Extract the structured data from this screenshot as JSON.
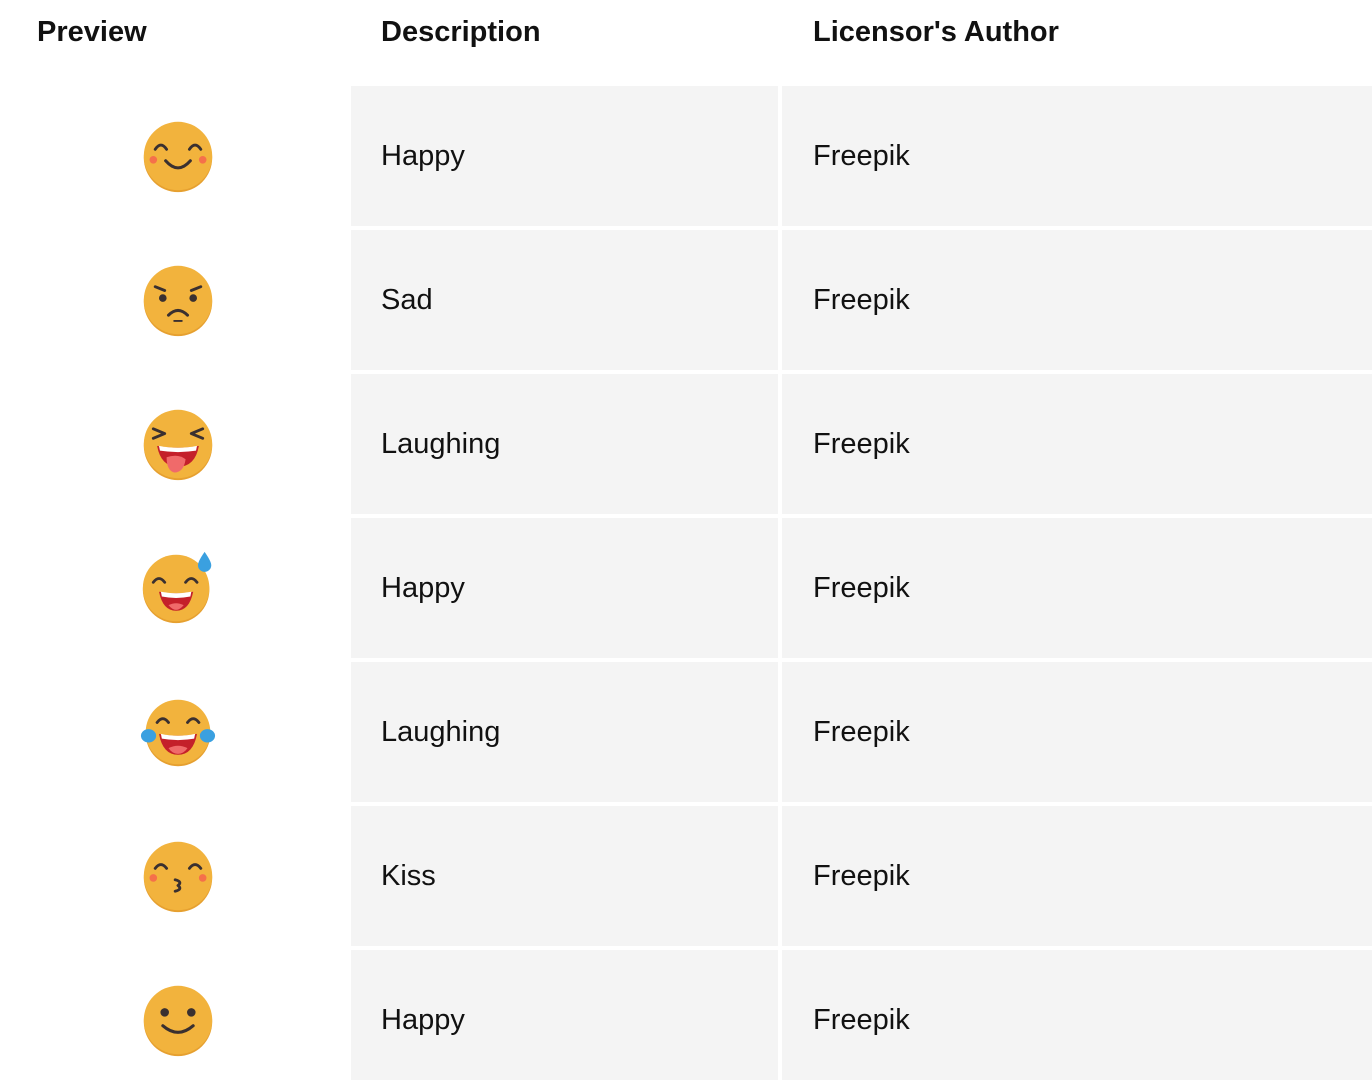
{
  "table": {
    "headers": {
      "preview": "Preview",
      "description": "Description",
      "author": "Licensor's Author"
    },
    "rows": [
      {
        "icon": "happy-smiling-face-icon",
        "description": "Happy",
        "author": "Freepik"
      },
      {
        "icon": "sad-face-icon",
        "description": "Sad",
        "author": "Freepik"
      },
      {
        "icon": "laughing-tongue-face-icon",
        "description": "Laughing",
        "author": "Freepik"
      },
      {
        "icon": "happy-sweat-face-icon",
        "description": "Happy",
        "author": "Freepik"
      },
      {
        "icon": "laughing-tears-face-icon",
        "description": "Laughing",
        "author": "Freepik"
      },
      {
        "icon": "kiss-face-icon",
        "description": "Kiss",
        "author": "Freepik"
      },
      {
        "icon": "happy-simple-face-icon",
        "description": "Happy",
        "author": "Freepik"
      }
    ]
  },
  "colors": {
    "face": "#f2b33d",
    "face_shadow": "#e6a030",
    "features": "#3a3030",
    "blush": "#f5704a",
    "mouth": "#c4202a",
    "tongue": "#f06a6a",
    "teeth": "#ffffff",
    "tear": "#3aa0e0",
    "cell_bg": "#f4f4f4"
  }
}
